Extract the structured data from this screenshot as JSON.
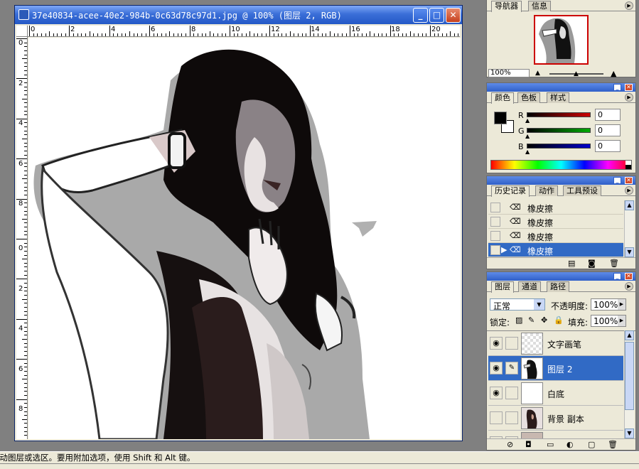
{
  "document": {
    "title": "37e40834-acee-40e2-984b-0c63d78c97d1.jpg @ 100% (图层 2, RGB)",
    "ruler_top_labels": [
      "0",
      "2",
      "4",
      "6",
      "8",
      "10",
      "12",
      "14",
      "16",
      "18",
      "20"
    ],
    "ruler_left_labels": [
      "0",
      "2",
      "4",
      "6",
      "8",
      "0",
      "2",
      "4",
      "6",
      "8"
    ]
  },
  "navigator": {
    "tabs": [
      "导航器",
      "信息"
    ],
    "zoom": "100%"
  },
  "color": {
    "tabs": [
      "颜色",
      "色板",
      "样式"
    ],
    "channels": [
      {
        "label": "R",
        "value": "0",
        "color": "#cc0000"
      },
      {
        "label": "G",
        "value": "0",
        "color": "#00aa00"
      },
      {
        "label": "B",
        "value": "0",
        "color": "#0000cc"
      }
    ]
  },
  "history": {
    "tabs": [
      "历史记录",
      "动作",
      "工具预设"
    ],
    "items": [
      "橡皮擦",
      "橡皮擦",
      "橡皮擦",
      "橡皮擦"
    ],
    "selected_index": 3
  },
  "layers": {
    "tabs": [
      "图层",
      "通道",
      "路径"
    ],
    "blend_mode": "正常",
    "opacity_label": "不透明度:",
    "opacity_value": "100%",
    "lock_label": "锁定:",
    "fill_label": "填充:",
    "fill_value": "100%",
    "items": [
      {
        "name": "文字画笔",
        "visible": true,
        "selected": false
      },
      {
        "name": "图层 2",
        "visible": true,
        "selected": true
      },
      {
        "name": "白底",
        "visible": true,
        "selected": false
      },
      {
        "name": "背景 副本",
        "visible": false,
        "selected": false
      }
    ]
  },
  "status": {
    "text": "移动图层或选区。要用附加选项，使用 Shift 和 Alt 键。"
  },
  "icons": {
    "eye": "eye-icon",
    "brush": "brush-icon",
    "eraser": "eraser-icon"
  }
}
